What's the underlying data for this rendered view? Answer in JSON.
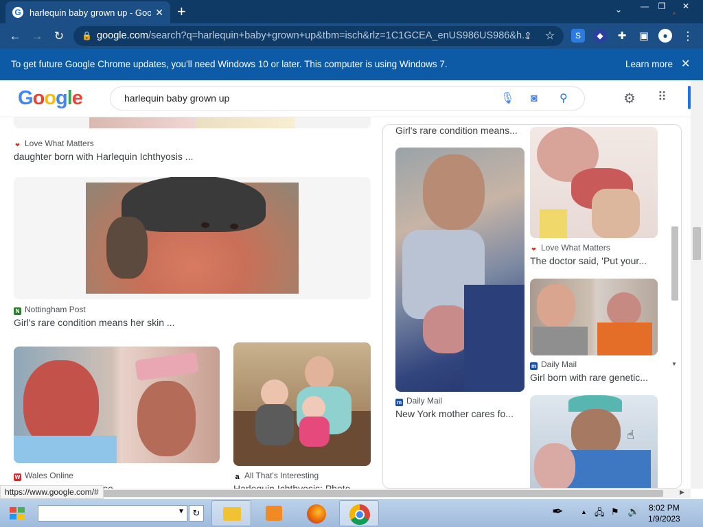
{
  "browser": {
    "tab_title": "harlequin baby grown up - Goog",
    "tab_favicon": "G",
    "tab_close": "✕",
    "new_tab": "+",
    "url_host": "google.com",
    "url_rest": "/search?q=harlequin+baby+grown+up&tbm=isch&rlz=1C1GCEA_enUS986US986&h...",
    "window_buttons": [
      "—",
      "❐",
      "✕"
    ],
    "tab_list": "⌄"
  },
  "infobar": {
    "message": "To get future Google Chrome updates, you'll need Windows 10 or later. This computer is using Windows 7.",
    "learn_more": "Learn more",
    "close": "✕"
  },
  "google": {
    "logo_letters": [
      "G",
      "o",
      "o",
      "g",
      "l",
      "e"
    ],
    "logo_colors": [
      "#4285f4",
      "#ea4335",
      "#fbbc05",
      "#4285f4",
      "#34a853",
      "#ea4335"
    ],
    "query": "harlequin baby grown up"
  },
  "results_left": [
    {
      "source": "Love What Matters",
      "caption": "daughter born with Harlequin Ichthyosis ..."
    },
    {
      "source": "Nottingham Post",
      "caption": "Girl's rare condition means her skin ..."
    },
    {
      "source": "Wales Online",
      "caption": "... whose skin grows so ..."
    },
    {
      "source": "All That's Interesting",
      "caption": "Harlequin Ichthyosis: Photo ..."
    }
  ],
  "panel": {
    "top_caption": "Girl's rare condition means...",
    "items": [
      {
        "source": "Daily Mail",
        "caption": "New York mother cares fo..."
      },
      {
        "source": "Love What Matters",
        "caption": "The doctor said, 'Put your..."
      },
      {
        "source": "Daily Mail",
        "caption": "Girl born with rare genetic..."
      }
    ]
  },
  "status_url": "https://www.google.com/#",
  "clock": {
    "time": "8:02 PM",
    "date": "1/9/2023"
  },
  "accent_colors": {
    "titlebar": "#0f3a66",
    "toolbar": "#1b4f86",
    "infobar": "#0d5aa7",
    "google_blue": "#1a73e8"
  }
}
